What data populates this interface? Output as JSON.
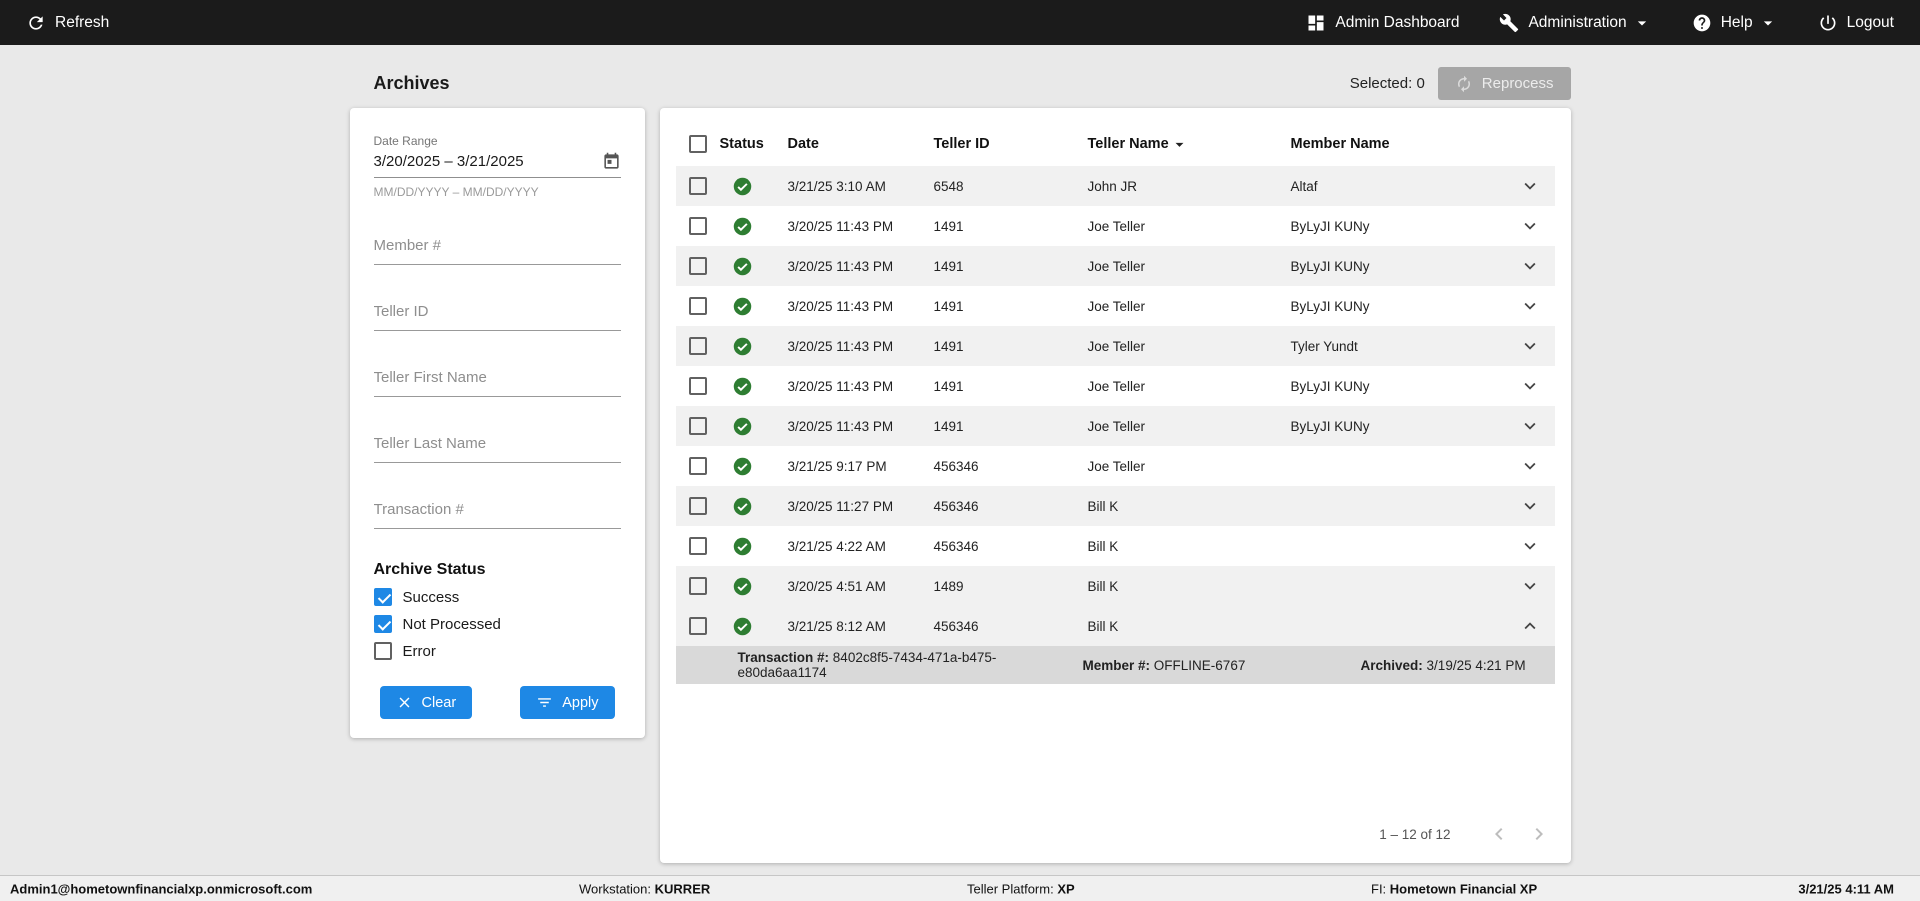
{
  "colors": {
    "accent": "#1e88e5",
    "success": "#2e7d32",
    "topbar": "#1b1b1b",
    "bg": "#e9e9e9",
    "row-alt": "#f1f1f1",
    "detail": "#d9d9d9"
  },
  "topbar": {
    "refresh": "Refresh",
    "admin_dashboard": "Admin Dashboard",
    "administration": "Administration",
    "help": "Help",
    "logout": "Logout"
  },
  "header": {
    "title": "Archives",
    "selected": "Selected: 0",
    "reprocess": "Reprocess"
  },
  "filters": {
    "date_range": {
      "label": "Date Range",
      "value": "3/20/2025 – 3/21/2025",
      "helper": "MM/DD/YYYY – MM/DD/YYYY"
    },
    "member_placeholder": "Member #",
    "teller_id_placeholder": "Teller ID",
    "teller_first_placeholder": "Teller First Name",
    "teller_last_placeholder": "Teller Last Name",
    "transaction_placeholder": "Transaction #",
    "archive_status": {
      "label": "Archive Status",
      "options": [
        {
          "label": "Success",
          "checked": true
        },
        {
          "label": "Not Processed",
          "checked": true
        },
        {
          "label": "Error",
          "checked": false
        }
      ]
    },
    "clear": "Clear",
    "apply": "Apply"
  },
  "table": {
    "columns": [
      {
        "label": "Status"
      },
      {
        "label": "Date"
      },
      {
        "label": "Teller ID"
      },
      {
        "label": "Teller Name",
        "sorted": "desc"
      },
      {
        "label": "Member Name"
      }
    ],
    "rows": [
      {
        "status": "success",
        "date": "3/21/25 3:10 AM",
        "teller_id": "6548",
        "teller_name": "John JR",
        "member_name": "Altaf"
      },
      {
        "status": "success",
        "date": "3/20/25 11:43 PM",
        "teller_id": "1491",
        "teller_name": "Joe Teller",
        "member_name": "ByLyJI KUNy"
      },
      {
        "status": "success",
        "date": "3/20/25 11:43 PM",
        "teller_id": "1491",
        "teller_name": "Joe Teller",
        "member_name": "ByLyJI KUNy"
      },
      {
        "status": "success",
        "date": "3/20/25 11:43 PM",
        "teller_id": "1491",
        "teller_name": "Joe Teller",
        "member_name": "ByLyJI KUNy"
      },
      {
        "status": "success",
        "date": "3/20/25 11:43 PM",
        "teller_id": "1491",
        "teller_name": "Joe Teller",
        "member_name": "Tyler Yundt"
      },
      {
        "status": "success",
        "date": "3/20/25 11:43 PM",
        "teller_id": "1491",
        "teller_name": "Joe Teller",
        "member_name": "ByLyJI KUNy"
      },
      {
        "status": "success",
        "date": "3/20/25 11:43 PM",
        "teller_id": "1491",
        "teller_name": "Joe Teller",
        "member_name": "ByLyJI KUNy"
      },
      {
        "status": "success",
        "date": "3/21/25 9:17 PM",
        "teller_id": "456346",
        "teller_name": "Joe Teller",
        "member_name": ""
      },
      {
        "status": "success",
        "date": "3/20/25 11:27 PM",
        "teller_id": "456346",
        "teller_name": "Bill K",
        "member_name": ""
      },
      {
        "status": "success",
        "date": "3/21/25 4:22 AM",
        "teller_id": "456346",
        "teller_name": "Bill K",
        "member_name": ""
      },
      {
        "status": "success",
        "date": "3/20/25 4:51 AM",
        "teller_id": "1489",
        "teller_name": "Bill K",
        "member_name": ""
      },
      {
        "status": "success",
        "date": "3/21/25 8:12 AM",
        "teller_id": "456346",
        "teller_name": "Bill K",
        "member_name": "",
        "expanded": true
      }
    ],
    "expanded_detail": {
      "transaction_label": "Transaction #:",
      "transaction_value": "8402c8f5-7434-471a-b475-e80da6aa1174",
      "member_label": "Member #:",
      "member_value": "OFFLINE-6767",
      "archived_label": "Archived:",
      "archived_value": "3/19/25 4:21 PM"
    },
    "pagination": {
      "range": "1 – 12 of 12"
    }
  },
  "statusbar": {
    "user": "Admin1@hometownfinancialxp.onmicrosoft.com",
    "workstation_label": "Workstation:",
    "workstation_value": "KURRER",
    "platform_label": "Teller Platform:",
    "platform_value": "XP",
    "fi_label": "FI:",
    "fi_value": "Hometown Financial XP",
    "datetime": "3/21/25 4:11 AM"
  }
}
